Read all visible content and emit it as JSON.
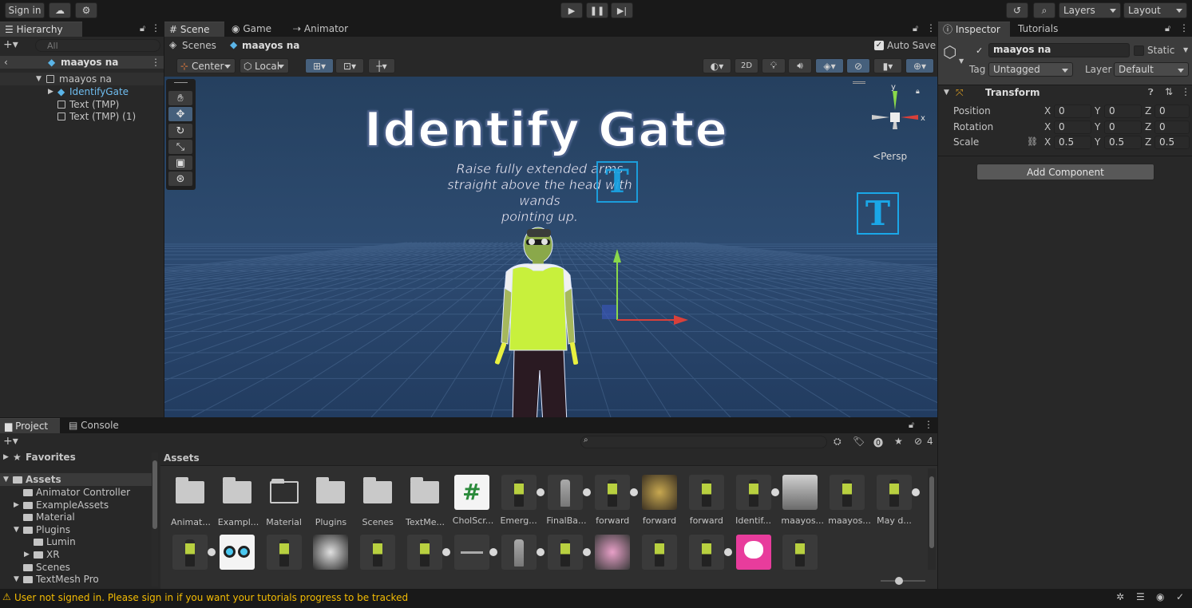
{
  "top": {
    "sign_in": "Sign in",
    "layers": "Layers",
    "layout": "Layout"
  },
  "hierarchy": {
    "tab": "Hierarchy",
    "search_placeholder": "All",
    "items": [
      "maayos na",
      "maayos na",
      "IdentifyGate",
      "Text (TMP)",
      "Text (TMP) (1)"
    ]
  },
  "scene": {
    "tabs": [
      "Scene",
      "Game",
      "Animator"
    ],
    "breadcrumb_root": "Scenes",
    "breadcrumb_current": "maayos na",
    "auto_save": "Auto Save",
    "pivot": "Center",
    "space": "Local",
    "mode_2d": "2D",
    "persp": "Persp",
    "title_text": "Identify Gate",
    "instruction_lines": [
      "Raise fully extended arms",
      "straight above the head with",
      "wands",
      "pointing up."
    ],
    "gizmo_x": "x",
    "gizmo_y": "y",
    "tmp_icon": "T"
  },
  "inspector": {
    "tabs": [
      "Inspector",
      "Tutorials"
    ],
    "object_name": "maayos na",
    "static": "Static",
    "tag_label": "Tag",
    "tag_value": "Untagged",
    "layer_label": "Layer",
    "layer_value": "Default",
    "component": "Transform",
    "rows": [
      {
        "label": "Position",
        "x": "0",
        "y": "0",
        "z": "0"
      },
      {
        "label": "Rotation",
        "x": "0",
        "y": "0",
        "z": "0"
      },
      {
        "label": "Scale",
        "x": "0.5",
        "y": "0.5",
        "z": "0.5"
      }
    ],
    "axis_x": "X",
    "axis_y": "Y",
    "axis_z": "Z",
    "add_component": "Add Component"
  },
  "project": {
    "tabs": [
      "Project",
      "Console"
    ],
    "hidden_count": "4",
    "favorites": "Favorites",
    "assets_root": "Assets",
    "tree": [
      "Animator Controller",
      "ExampleAssets",
      "Material",
      "Plugins",
      "Lumin",
      "XR",
      "Scenes",
      "TextMesh Pro"
    ],
    "breadcrumb": "Assets",
    "row1": [
      "Animat...",
      "Exampl...",
      "Material",
      "Plugins",
      "Scenes",
      "TextMe...",
      "CholScr...",
      "Emerg...",
      "FinalBa...",
      "forward",
      "forward",
      "forward",
      "Identif...",
      "maayos...",
      "maayos...",
      "May d..."
    ]
  },
  "status": {
    "message": "User not signed in. Please sign in if you want your tutorials progress to be tracked",
    "warning_color": "#f4bc02"
  },
  "colors": {
    "scene_sky": "#2a4466",
    "scene_ground": "#26436b",
    "vest": "#c8f03c",
    "tmp_blue": "#1aa7e8",
    "selected_blue": "#2c5d87"
  }
}
